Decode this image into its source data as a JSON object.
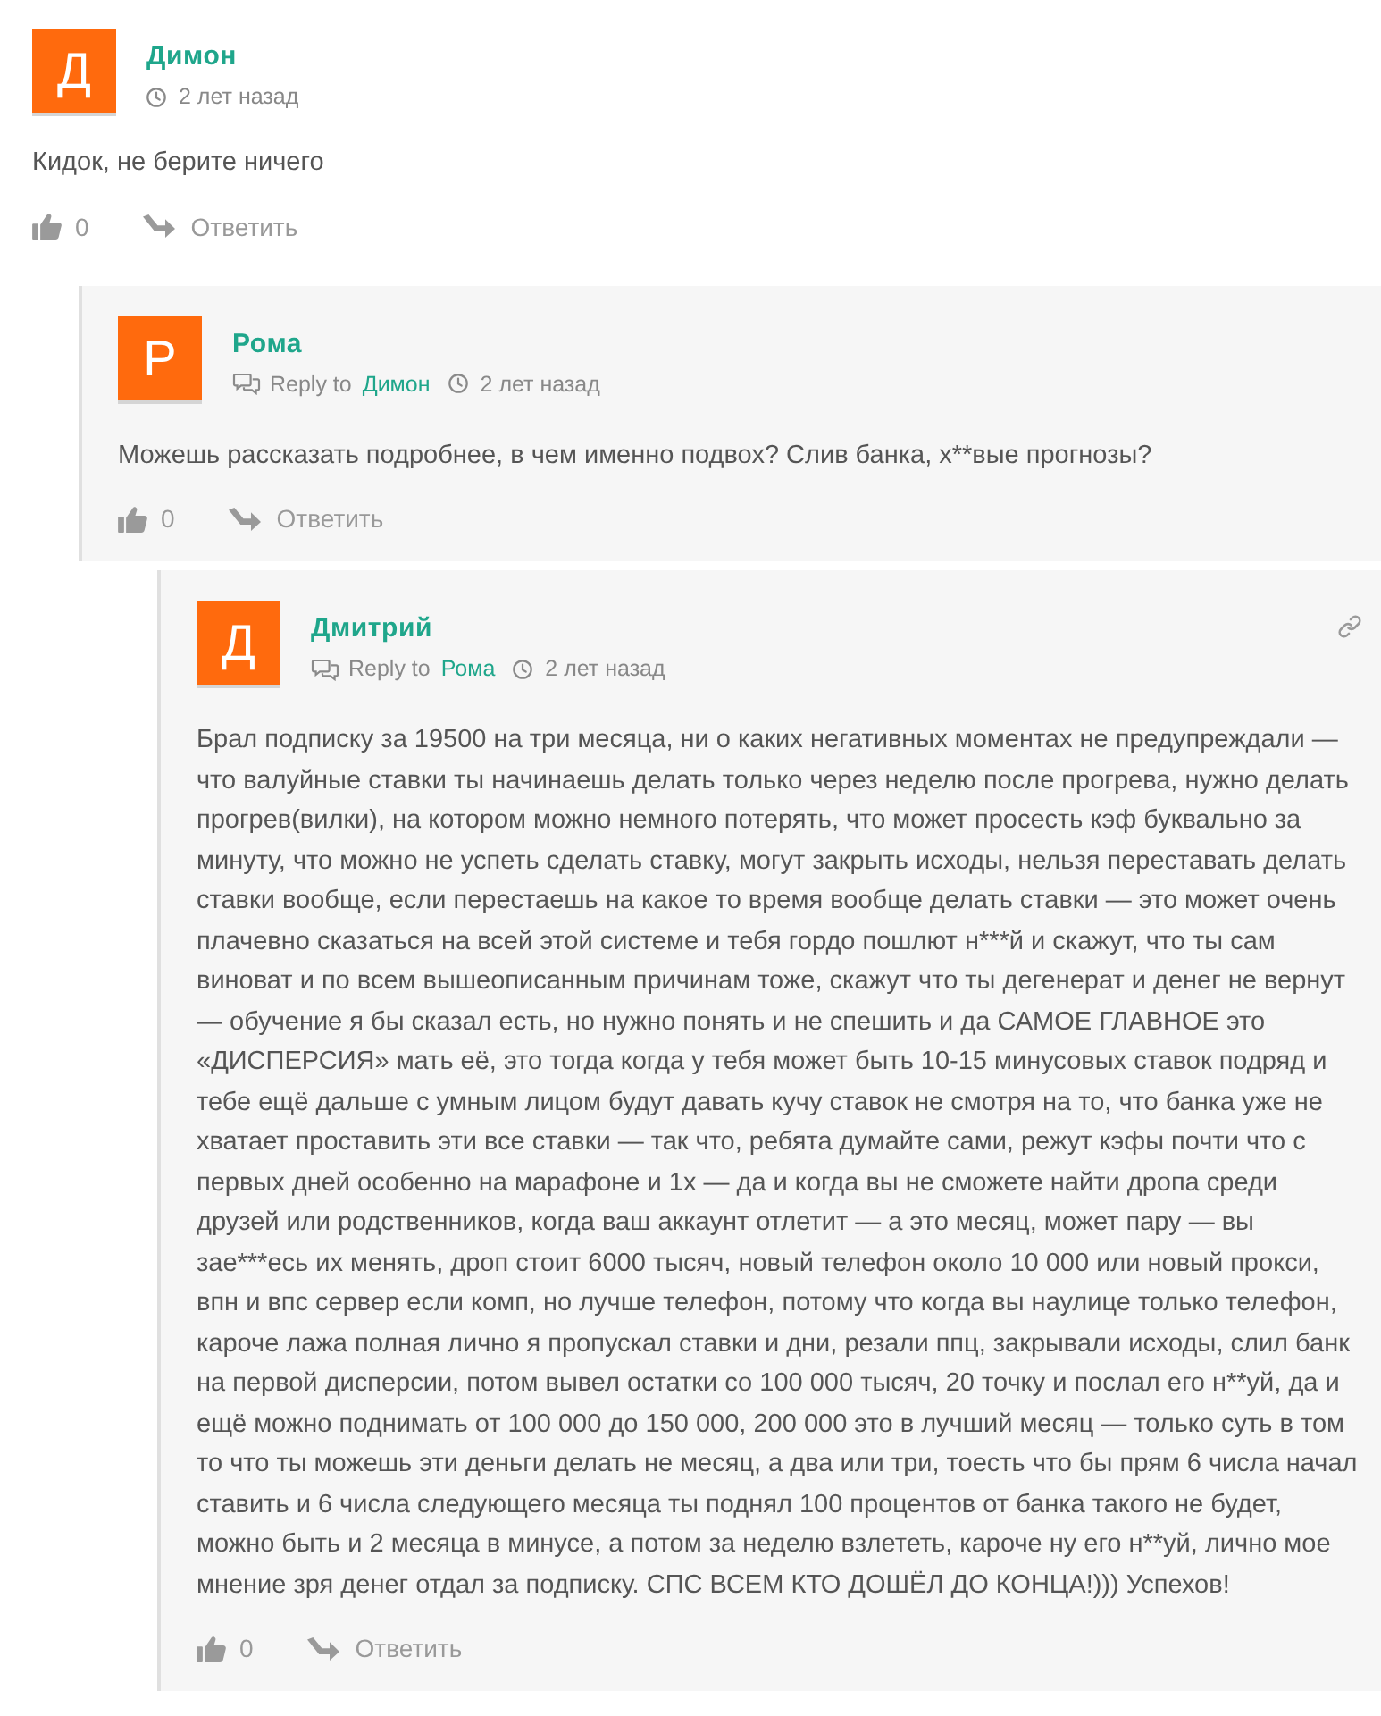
{
  "comments": [
    {
      "avatar_letter": "Д",
      "author": "Димон",
      "time": "2 лет назад",
      "text": "Кидок, не берите ничего",
      "likes": "0",
      "reply_button": "Ответить",
      "permalink": false,
      "children": [
        {
          "avatar_letter": "Р",
          "author": "Рома",
          "reply_to_label": "Reply to",
          "reply_to": "Димон",
          "time": "2 лет назад",
          "text": "Можешь рассказать подробнее, в чем именно подвох? Слив банка, х**вые прогнозы?",
          "likes": "0",
          "reply_button": "Ответить",
          "permalink": false,
          "children": [
            {
              "avatar_letter": "Д",
              "author": "Дмитрий",
              "reply_to_label": "Reply to",
              "reply_to": "Рома",
              "time": "2 лет назад",
              "text": "Брал подписку за 19500 на три месяца, ни о каких негативных моментах не предупреждали — что валуйные ставки ты начинаешь делать только через неделю после прогрева, нужно делать прогрев(вилки), на котором можно немного потерять, что может просесть кэф буквально за минуту, что можно не успеть сделать ставку, могут закрыть исходы, нельзя переставать делать ставки вообще, если перестаешь на какое то время вообще делать ставки — это может очень плачевно сказаться на всей этой системе и тебя гордо пошлют н***й и скажут, что ты сам виноват и по всем вышеописанным причинам тоже, скажут что ты дегенерат и денег не вернут — обучение я бы сказал есть, но нужно понять и не спешить и да САМОЕ ГЛАВНОЕ это «ДИСПЕРСИЯ» мать её, это тогда когда у тебя может быть 10-15 минусовых ставок подряд и тебе ещё дальше с умным лицом будут давать кучу ставок не смотря на то, что банка уже не хватает проставить эти все ставки — так что, ребята думайте сами, режут кэфы почти что с первых дней особенно на марафоне и 1х — да и когда вы не сможете найти дропа среди друзей или родственников, когда ваш аккаунт отлетит — а это месяц, может пару — вы зае***есь их менять, дроп стоит 6000 тысяч, новый телефон около 10 000 или новый прокси, впн и впс сервер если комп, но лучше телефон, потому что когда вы наулице только телефон, кароче лажа полная лично я пропускал ставки и дни, резали ппц, закрывали исходы, слил банк на первой дисперсии, потом вывел остатки со 100 000 тысяч, 20 точку и послал его н**уй, да и ещё можно поднимать от 100 000 до 150 000, 200 000 это в лучший месяц — только суть в том то что ты можешь эти деньги делать не месяц, а два или три, тоесть что бы прям 6 числа начал ставить и 6 числа следующего месяца ты поднял 100 процентов от банка такого не будет, можно быть и 2 месяца в минусе, а потом за неделю взлететь, кароче ну его н**уй, лично мое мнение зря денег отдал за подписку. СПС ВСЕМ КТО ДОШЁЛ ДО КОНЦА!))) Успехов!",
              "likes": "0",
              "reply_button": "Ответить",
              "permalink": true
            }
          ]
        }
      ]
    }
  ]
}
